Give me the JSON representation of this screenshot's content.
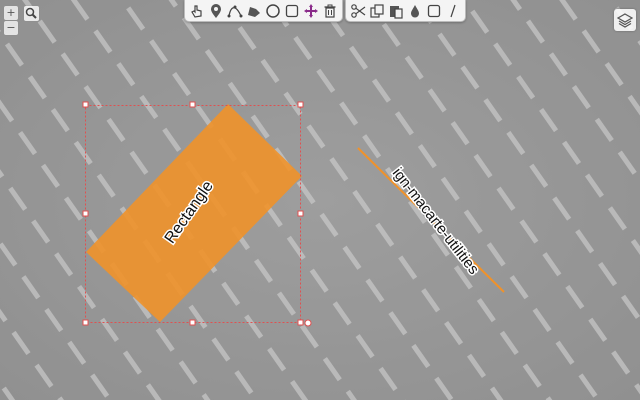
{
  "map": {
    "features": [
      {
        "type": "polygon",
        "label": "Rectangle",
        "fill": "#f0922a",
        "selected": true
      },
      {
        "type": "line",
        "label": "ign-macarte-utilities",
        "stroke": "#f0922a"
      }
    ]
  },
  "zoom": {
    "in_label": "+",
    "out_label": "−"
  },
  "toolbar": {
    "drawing_tools": [
      "select-icon",
      "marker-icon",
      "polyline-icon",
      "polygon-icon",
      "circle-icon",
      "rectangle-icon",
      "move-icon",
      "delete-icon"
    ],
    "edit_tools": [
      "cut-icon",
      "copy-icon",
      "paste-icon",
      "color-icon",
      "frame-icon",
      "line-style-icon"
    ]
  },
  "colors": {
    "accent": "#f0922a",
    "selection": "#e05050",
    "move": "#8a2b8a"
  },
  "layers_button": {
    "icon": "layers-icon"
  }
}
